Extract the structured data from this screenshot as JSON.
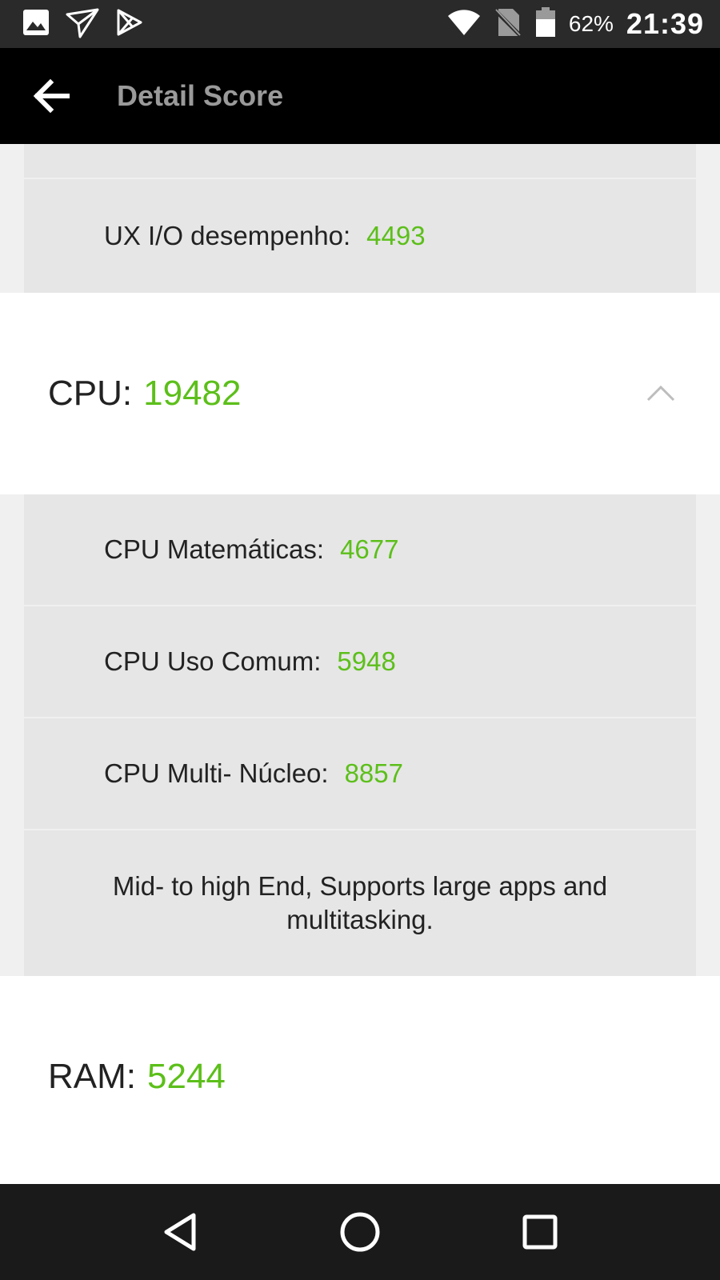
{
  "status_bar": {
    "battery_percent": "62%",
    "time": "21:39",
    "icons": [
      "gallery-icon",
      "paper-plane-icon",
      "play-store-icon",
      "wifi-icon",
      "no-sim-icon",
      "battery-icon"
    ]
  },
  "app_bar": {
    "title": "Detail Score",
    "back_icon": "arrow-left-icon"
  },
  "sections": {
    "ux_partial": {
      "rows": [
        {
          "label": "UX I/O desempenho:",
          "value": "4493"
        }
      ]
    },
    "cpu": {
      "label": "CPU:",
      "value": "19482",
      "expanded": true,
      "rows": [
        {
          "label": "CPU Matemáticas:",
          "value": "4677"
        },
        {
          "label": "CPU Uso Comum:",
          "value": "5948"
        },
        {
          "label": "CPU Multi- Núcleo:",
          "value": "8857"
        }
      ],
      "description": "Mid- to high End, Supports large apps and multitasking."
    },
    "ram": {
      "label": "RAM:",
      "value": "5244"
    }
  },
  "nav_bar": {
    "icons": [
      "back-triangle-icon",
      "home-circle-icon",
      "recents-square-icon"
    ]
  },
  "colors": {
    "accent_green": "#5cbf1a",
    "app_bar": "#000000",
    "status_bar": "#2a2a2a",
    "card": "#e6e6e6"
  }
}
